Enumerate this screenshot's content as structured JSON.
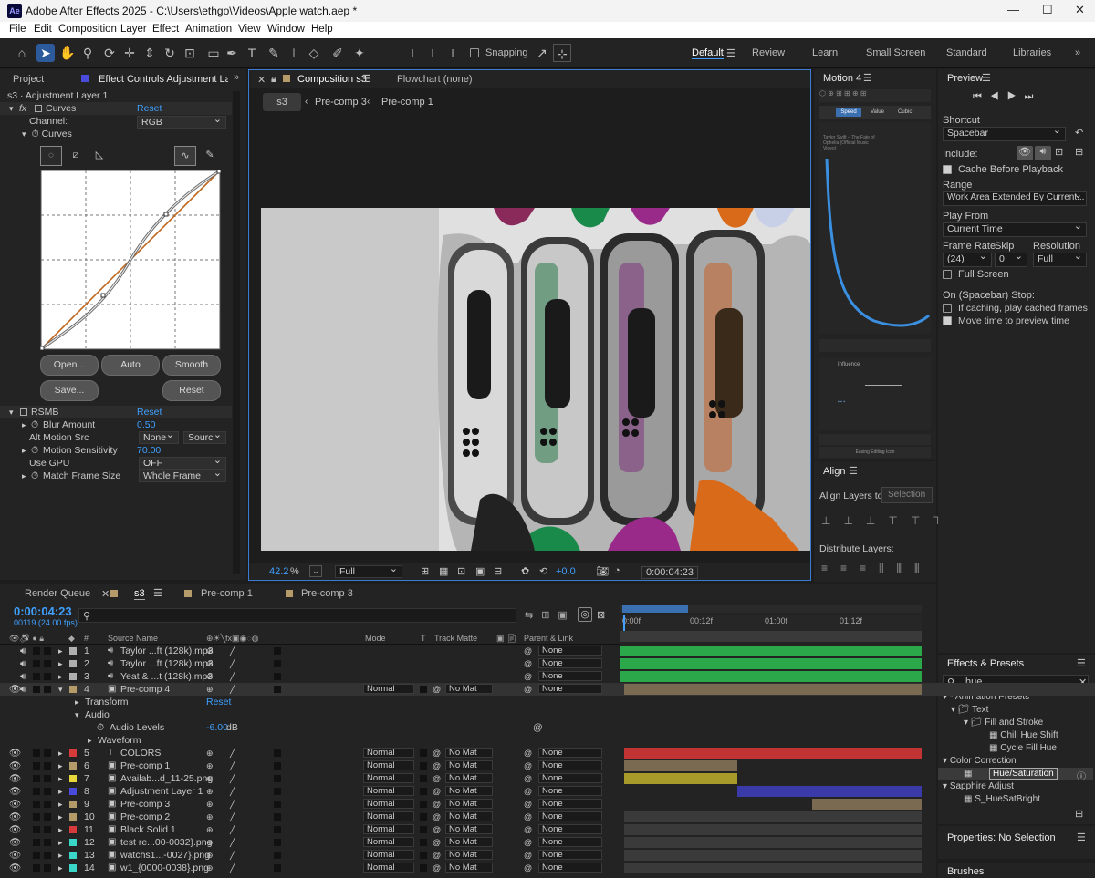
{
  "window": {
    "title": "Adobe After Effects 2025 - C:\\Users\\ethgo\\Videos\\Apple watch.aep *",
    "logo": "Ae"
  },
  "menu": [
    "File",
    "Edit",
    "Composition",
    "Layer",
    "Effect",
    "Animation",
    "View",
    "Window",
    "Help"
  ],
  "toolbar": {
    "snapping_label": "Snapping",
    "workspaces": [
      "Default",
      "Review",
      "Learn",
      "Small Screen",
      "Standard",
      "Libraries"
    ]
  },
  "effect_panel": {
    "tab_project": "Project",
    "tab_effect": "Effect Controls Adjustment Layer",
    "layer_title": "s3 · Adjustment Layer 1",
    "curves": {
      "name": "Curves",
      "reset": "Reset",
      "fx": "fx",
      "channel_label": "Channel:",
      "channel_value": "RGB",
      "curves_label": "Curves",
      "buttons": [
        "Open...",
        "Auto",
        "Smooth",
        "Save...",
        "Reset"
      ]
    },
    "rsmb": {
      "name": "RSMB",
      "reset": "Reset",
      "props": [
        {
          "label": "Blur Amount",
          "value": "0.50",
          "blue": true
        },
        {
          "label": "Alt Motion Src",
          "value": "None",
          "value2": "Sourc"
        },
        {
          "label": "Motion Sensitivity",
          "value": "70.00",
          "blue": true
        },
        {
          "label": "Use GPU",
          "value": "OFF"
        },
        {
          "label": "Match Frame Size",
          "value": "Whole Frame"
        }
      ]
    }
  },
  "comp_panel": {
    "tab": "Composition s3",
    "tab2": "Flowchart (none)",
    "breadcrumbs": [
      "s3",
      "Pre-comp 3",
      "Pre-comp 1"
    ],
    "zoom": "42.2",
    "zoom_unit": "%",
    "resolution": "Full",
    "exposure": "+0.0",
    "timecode": "0:00:04:23"
  },
  "motion_panel": {
    "title": "Motion 4",
    "tabs": [
      "Speed",
      "Value",
      "Cubic"
    ],
    "text": "Taylor Swift – The Fate of Ophelia (Official Music Video)",
    "influence": "Influence",
    "footer": "Easing Editing Icon"
  },
  "align_panel": {
    "title": "Align",
    "align_to_label": "Align Layers to:",
    "align_to_value": "Selection",
    "distribute_label": "Distribute Layers:"
  },
  "preview_panel": {
    "title": "Preview",
    "shortcut_label": "Shortcut",
    "shortcut_value": "Spacebar",
    "include_label": "Include:",
    "cache_label": "Cache Before Playback",
    "range_label": "Range",
    "range_value": "Work Area Extended By Current...",
    "playfrom_label": "Play From",
    "playfrom_value": "Current Time",
    "framerate_label": "Frame Rate",
    "skip_label": "Skip",
    "resolution_label": "Resolution",
    "framerate_value": "(24)",
    "skip_value": "0",
    "resolution_value": "Full",
    "fullscreen_label": "Full Screen",
    "stop_label": "On (Spacebar) Stop:",
    "stop_opt1": "If caching, play cached frames",
    "stop_opt2": "Move time to preview time"
  },
  "effects_presets": {
    "title": "Effects & Presets",
    "search": "hue",
    "tree": [
      "* Animation Presets",
      "Text",
      "Fill and Stroke",
      "Chill Hue Shift",
      "Cycle Fill Hue",
      "Color Correction",
      "Hue/Saturation",
      "Sapphire Adjust",
      "S_HueSatBright"
    ]
  },
  "properties": {
    "title": "Properties: No Selection"
  },
  "brushes": {
    "title": "Brushes"
  },
  "timeline": {
    "tabs": [
      "Render Queue",
      "s3",
      "Pre-comp 1",
      "Pre-comp 3"
    ],
    "timecode": "0:00:04:23",
    "fps": "00119 (24.00 fps)",
    "ruler": [
      "0:00f",
      "00:12f",
      "01:00f",
      "01:12f"
    ],
    "headers": {
      "source": "Source Name",
      "mode": "Mode",
      "t": "T",
      "trackmatte": "Track Matte",
      "parent": "Parent & Link"
    },
    "layers": [
      {
        "num": "1",
        "name": "Taylor ...ft (128k).mp3",
        "color": "#b0b0b0",
        "type": "audio",
        "parent": "None"
      },
      {
        "num": "2",
        "name": "Taylor ...ft (128k).mp3",
        "color": "#b0b0b0",
        "type": "audio",
        "parent": "None"
      },
      {
        "num": "3",
        "name": "Yeat & ...t (128k).mp3",
        "color": "#b0b0b0",
        "type": "audio",
        "parent": "None"
      },
      {
        "num": "4",
        "name": "Pre-comp 4",
        "color": "#b59a6a",
        "type": "comp",
        "mode": "Normal",
        "matte": "No Mat",
        "parent": "None"
      }
    ],
    "sub": {
      "transform": "Transform",
      "reset": "Reset",
      "audio": "Audio",
      "audio_levels": "Audio Levels",
      "audio_value": "-6.00",
      "audio_unit": "dB",
      "waveform": "Waveform"
    },
    "layers2": [
      {
        "num": "5",
        "name": "COLORS",
        "color": "#d63a3a",
        "mode": "Normal",
        "matte": "No Mat",
        "parent": "None"
      },
      {
        "num": "6",
        "name": "Pre-comp 1",
        "color": "#b59a6a",
        "mode": "Normal",
        "matte": "No Mat",
        "parent": "None"
      },
      {
        "num": "7",
        "name": "Availab...d_11-25.png",
        "color": "#e8d83a",
        "mode": "Normal",
        "matte": "No Mat",
        "parent": "None"
      },
      {
        "num": "8",
        "name": "Adjustment Layer 1",
        "color": "#4a4adc",
        "mode": "Normal",
        "matte": "No Mat",
        "parent": "None"
      },
      {
        "num": "9",
        "name": "Pre-comp 3",
        "color": "#b59a6a",
        "mode": "Normal",
        "matte": "No Mat",
        "parent": "None"
      },
      {
        "num": "10",
        "name": "Pre-comp 2",
        "color": "#b59a6a",
        "mode": "Normal",
        "matte": "No Mat",
        "parent": "None"
      },
      {
        "num": "11",
        "name": "Black Solid 1",
        "color": "#d63a3a",
        "mode": "Normal",
        "matte": "No Mat",
        "parent": "None"
      },
      {
        "num": "12",
        "name": "test re...00-0032}.png",
        "color": "#3ad6c8",
        "mode": "Normal",
        "matte": "No Mat",
        "parent": "None"
      },
      {
        "num": "13",
        "name": "watchs1...-0027}.png",
        "color": "#3ad6c8",
        "mode": "Normal",
        "matte": "No Mat",
        "parent": "None"
      },
      {
        "num": "14",
        "name": "w1_{0000-0038}.png",
        "color": "#3ad6c8",
        "mode": "Normal",
        "matte": "No Mat",
        "parent": "None"
      }
    ]
  }
}
